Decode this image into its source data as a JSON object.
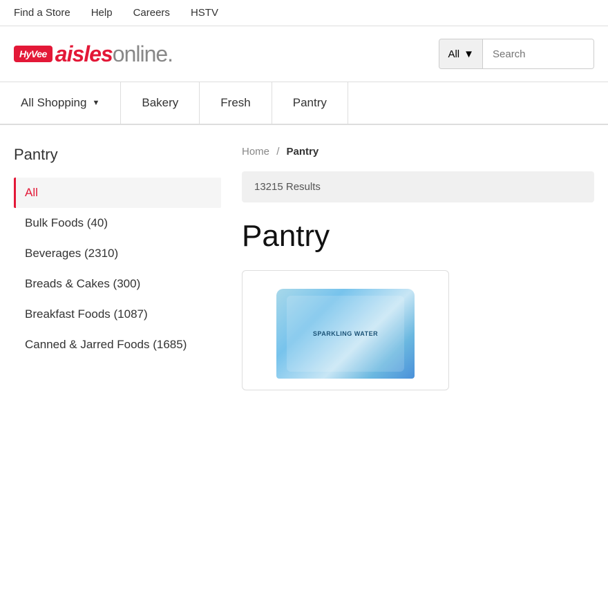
{
  "utility_bar": {
    "links": [
      {
        "label": "Find a Store"
      },
      {
        "label": "Help"
      },
      {
        "label": "Careers"
      },
      {
        "label": "HSTV"
      }
    ]
  },
  "header": {
    "logo_hy": "HyVee",
    "logo_aisles": "aisles",
    "logo_online": "online.",
    "search_category": "All",
    "search_placeholder": "Search"
  },
  "nav": {
    "items": [
      {
        "label": "All Shopping",
        "has_chevron": true
      },
      {
        "label": "Bakery",
        "has_chevron": false
      },
      {
        "label": "Fresh",
        "has_chevron": false
      },
      {
        "label": "Pantry",
        "has_chevron": false
      }
    ]
  },
  "sidebar": {
    "title": "Pantry",
    "items": [
      {
        "label": "All",
        "active": true
      },
      {
        "label": "Bulk Foods (40)"
      },
      {
        "label": "Beverages (2310)"
      },
      {
        "label": "Breads & Cakes (300)"
      },
      {
        "label": "Breakfast Foods (1087)"
      },
      {
        "label": "Canned & Jarred Foods (1685)"
      }
    ]
  },
  "main": {
    "breadcrumb_home": "Home",
    "breadcrumb_sep": "/",
    "breadcrumb_current": "Pantry",
    "results": "13215 Results",
    "page_title": "Pantry",
    "product": {
      "name": "Sparkling Water",
      "image_label": "SPARKLING\nWATER"
    }
  }
}
